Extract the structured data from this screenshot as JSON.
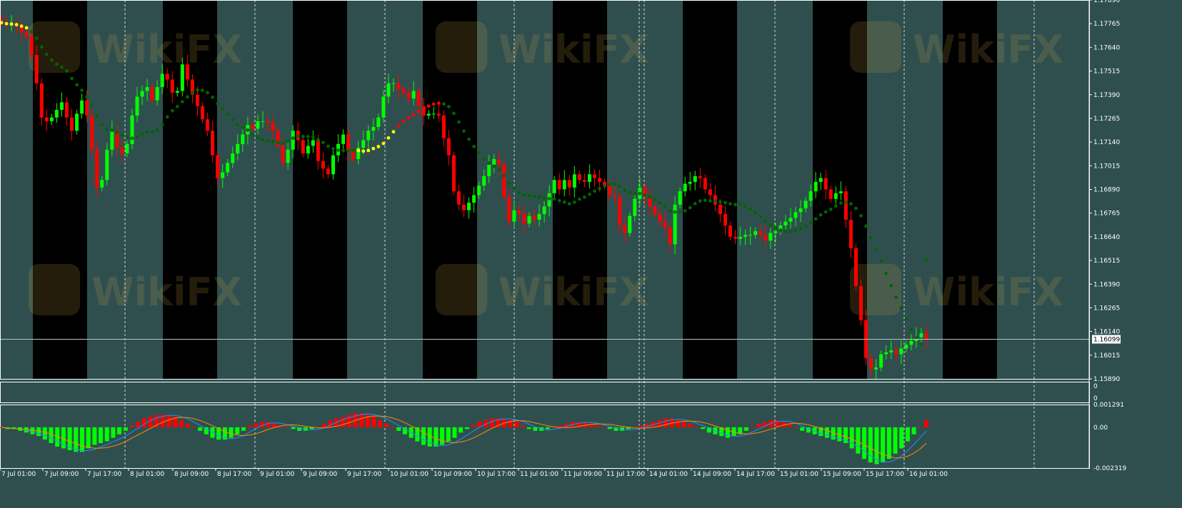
{
  "chart_data": [
    {
      "panel": "price",
      "type": "candlestick",
      "instrument_note": "",
      "y_ticks": [
        "1.17890",
        "1.17765",
        "1.17640",
        "1.17515",
        "1.17390",
        "1.17265",
        "1.17140",
        "1.17015",
        "1.16890",
        "1.16765",
        "1.16640",
        "1.16515",
        "1.16390",
        "1.16265",
        "1.16140",
        "1.16015",
        "1.15890"
      ],
      "ylim": [
        1.1589,
        1.1789
      ],
      "current_price": "1.16099",
      "x_tick_labels": [
        "7 Jul 01:00",
        "7 Jul 09:00",
        "7 Jul 17:00",
        "8 Jul 01:00",
        "8 Jul 09:00",
        "8 Jul 17:00",
        "9 Jul 01:00",
        "9 Jul 09:00",
        "9 Jul 17:00",
        "10 Jul 01:00",
        "10 Jul 09:00",
        "10 Jul 17:00",
        "11 Jul 01:00",
        "11 Jul 09:00",
        "11 Jul 17:00",
        "14 Jul 01:00",
        "14 Jul 09:00",
        "14 Jul 17:00",
        "15 Jul 01:00",
        "15 Jul 09:00",
        "15 Jul 17:00",
        "16 Jul 01:00"
      ],
      "watermark": "WikiFX",
      "colors": {
        "background": "#2f4f4f",
        "session_band": "#000000",
        "bull": "#00ff00",
        "bear": "#ff0000",
        "ma_down": "#006400",
        "ma_flat": "#ffff00",
        "ma_up": "#ff0000"
      },
      "close_series": [
        1.1777,
        1.1776,
        1.1776,
        1.1775,
        1.1772,
        1.177,
        1.176,
        1.1745,
        1.1727,
        1.1725,
        1.1727,
        1.1731,
        1.1735,
        1.1727,
        1.172,
        1.1729,
        1.1736,
        1.1728,
        1.171,
        1.169,
        1.1694,
        1.171,
        1.172,
        1.1711,
        1.1708,
        1.1713,
        1.1728,
        1.1738,
        1.1741,
        1.1743,
        1.1736,
        1.1743,
        1.175,
        1.1747,
        1.174,
        1.1741,
        1.1755,
        1.1747,
        1.1739,
        1.1733,
        1.1726,
        1.172,
        1.1707,
        1.1695,
        1.1698,
        1.1703,
        1.1708,
        1.1713,
        1.1718,
        1.1723,
        1.1721,
        1.1725,
        1.1725,
        1.1724,
        1.172,
        1.1712,
        1.1703,
        1.171,
        1.172,
        1.1715,
        1.1708,
        1.1712,
        1.1715,
        1.1704,
        1.17,
        1.1697,
        1.1707,
        1.1713,
        1.1718,
        1.1709,
        1.1705,
        1.1711,
        1.1715,
        1.172,
        1.1722,
        1.1727,
        1.1738,
        1.1745,
        1.1745,
        1.1742,
        1.174,
        1.1737,
        1.1741,
        1.1733,
        1.1728,
        1.1729,
        1.1729,
        1.1728,
        1.1716,
        1.1707,
        1.1688,
        1.1681,
        1.1678,
        1.1682,
        1.1686,
        1.1691,
        1.1696,
        1.1702,
        1.1705,
        1.1702,
        1.1685,
        1.1672,
        1.1678,
        1.1676,
        1.1671,
        1.1675,
        1.1673,
        1.1676,
        1.168,
        1.1687,
        1.1694,
        1.1689,
        1.1694,
        1.169,
        1.1697,
        1.1694,
        1.1693,
        1.1697,
        1.1695,
        1.1693,
        1.1691,
        1.1686,
        1.1685,
        1.167,
        1.1666,
        1.1675,
        1.1684,
        1.169,
        1.1685,
        1.168,
        1.1676,
        1.1672,
        1.1669,
        1.166,
        1.1681,
        1.1688,
        1.1692,
        1.1693,
        1.1696,
        1.1695,
        1.1689,
        1.1686,
        1.1681,
        1.1676,
        1.167,
        1.1664,
        1.1663,
        1.1664,
        1.1665,
        1.1665,
        1.1667,
        1.1665,
        1.1662,
        1.1666,
        1.1667,
        1.167,
        1.1672,
        1.1674,
        1.1677,
        1.1679,
        1.1683,
        1.1688,
        1.1693,
        1.1695,
        1.1689,
        1.1684,
        1.1687,
        1.1688,
        1.1673,
        1.1658,
        1.1638,
        1.162,
        1.16,
        1.1594,
        1.1595,
        1.1602,
        1.1603,
        1.1604,
        1.1602,
        1.1605,
        1.1607,
        1.1609,
        1.1611,
        1.1613,
        1.161
      ],
      "ma_series": [
        {
          "name": "",
          "color": "#ffff00",
          "from_index": 0,
          "values": [
            1.1777,
            1.1776,
            1.1775,
            1.1773,
            1.1771,
            1.1768
          ]
        },
        {
          "name": "",
          "color": "#006400",
          "from_index": 6,
          "values": "computed"
        },
        {
          "name": "",
          "color": "#ffff00",
          "from_index": 71,
          "values": "computed"
        },
        {
          "name": "",
          "color": "#ff0000",
          "from_index": 79,
          "values": "computed"
        },
        {
          "name": "",
          "color": "#006400",
          "from_index": 88,
          "values": "computed"
        }
      ],
      "ma_last": 1.1652
    },
    {
      "panel": "middle",
      "type": "indicator",
      "y_ticks": [
        "0",
        "0"
      ]
    },
    {
      "panel": "macd",
      "type": "histogram",
      "y_ticks": [
        "0.001291",
        "0.00",
        "-0.002319"
      ],
      "ylim": [
        -0.002319,
        0.001291
      ],
      "colors": {
        "positive": "#ff0000",
        "negative": "#00ff00",
        "main_line": "#1e90ff",
        "signal_line": "#ff8c00"
      },
      "histogram": [
        0.0,
        -0.0001,
        -0.0001,
        -0.0002,
        -0.0003,
        -0.0004,
        -0.0005,
        -0.0007,
        -0.0009,
        -0.0011,
        -0.0012,
        -0.0013,
        -0.0014,
        -0.0014,
        -0.0012,
        -0.001,
        -0.0009,
        -0.0008,
        -0.0006,
        -0.0004,
        -0.0002,
        0.0001,
        0.0003,
        0.0005,
        0.0006,
        0.0007,
        0.0007,
        0.0007,
        0.0006,
        0.0004,
        0.0002,
        0.0,
        -0.0002,
        -0.0004,
        -0.0006,
        -0.0007,
        -0.0007,
        -0.0006,
        -0.0004,
        -0.0002,
        0.0001,
        0.0002,
        0.0003,
        0.0003,
        0.0002,
        0.0001,
        0.0,
        -0.0001,
        -0.0002,
        -0.0002,
        -0.0001,
        0.0,
        0.0002,
        0.0004,
        0.0005,
        0.0006,
        0.0007,
        0.0008,
        0.0008,
        0.0007,
        0.0006,
        0.0004,
        0.0002,
        0.0,
        -0.0002,
        -0.0004,
        -0.0006,
        -0.0008,
        -0.001,
        -0.0011,
        -0.0011,
        -0.001,
        -0.0008,
        -0.0006,
        -0.0003,
        -0.0001,
        0.0001,
        0.0003,
        0.0004,
        0.0005,
        0.0005,
        0.0005,
        0.0004,
        0.0003,
        0.0001,
        -0.0001,
        -0.0002,
        -0.0002,
        -0.0001,
        0.0,
        0.0001,
        0.0002,
        0.0003,
        0.0003,
        0.0003,
        0.0002,
        0.0001,
        0.0,
        -0.0001,
        -0.0002,
        -0.0002,
        -0.0001,
        0.0,
        0.0001,
        0.0002,
        0.0003,
        0.0004,
        0.0005,
        0.0005,
        0.0004,
        0.0003,
        0.0002,
        0.0,
        -0.0001,
        -0.0003,
        -0.0004,
        -0.0005,
        -0.0006,
        -0.0005,
        -0.0004,
        -0.0002,
        0.0,
        0.0002,
        0.0003,
        0.0004,
        0.0004,
        0.0003,
        0.0002,
        0.0,
        -0.0002,
        -0.0003,
        -0.0004,
        -0.0005,
        -0.0006,
        -0.0007,
        -0.0008,
        -0.0009,
        -0.0012,
        -0.0015,
        -0.0018,
        -0.002,
        -0.0021,
        -0.002,
        -0.0018,
        -0.0015,
        -0.0012,
        -0.0008,
        -0.0004,
        0.0,
        0.0004
      ]
    }
  ]
}
